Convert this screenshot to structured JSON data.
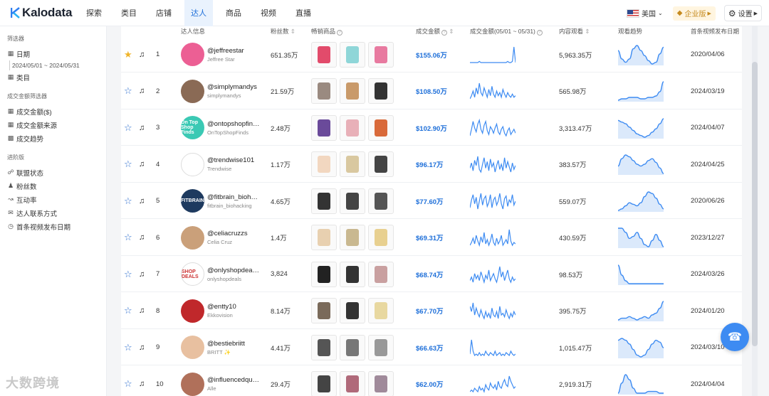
{
  "app": {
    "name": "Kalodata"
  },
  "nav": {
    "items": [
      "探索",
      "类目",
      "店铺",
      "达人",
      "商品",
      "视频",
      "直播"
    ],
    "active_index": 3,
    "country": "美国",
    "enterprise": "企业版",
    "settings": "设置"
  },
  "sidebar": {
    "filter_title": "筛选器",
    "date_label": "日期",
    "date_range": "2024/05/01 ~ 2024/05/31",
    "category_label": "类目",
    "gmv_filter_title": "成交金额筛选器",
    "gmv_items": [
      "成交金额($)",
      "成交金额来源",
      "成交趋势"
    ],
    "advanced_title": "进阶版",
    "advanced_items": [
      "联盟状态",
      "粉丝数",
      "互动率",
      "达人联系方式",
      "首条视频发布日期"
    ]
  },
  "watermark": "大数跨境",
  "table": {
    "headers": {
      "influencer": "达人信息",
      "fans": "粉丝数",
      "products": "畅销商品",
      "gmv": "成交金额",
      "gmv_trend": "成交金额(05/01 ~ 05/31)",
      "views": "内容观看",
      "view_trend": "观看趋势",
      "first_video": "首条视频发布日期"
    },
    "rows": [
      {
        "rank": "1",
        "handle": "@jeffreestar",
        "name": "Jeffree Star",
        "fans": "651.35万",
        "gmv": "$155.06万",
        "views": "5,963.35万",
        "date": "2020/04/06",
        "starred": true,
        "avatar_color": "#ec5f94",
        "avatar_text": "",
        "gmv_trend": [
          2,
          2,
          2,
          2,
          2,
          2,
          3,
          2,
          2,
          2,
          2,
          2,
          2,
          2,
          2,
          2,
          2,
          2,
          2,
          2,
          2,
          2,
          2,
          2,
          3,
          2,
          2,
          3,
          16,
          2
        ],
        "view_trend": [
          12,
          7,
          5,
          7,
          13,
          15,
          12,
          9,
          6,
          4,
          5,
          10,
          14
        ]
      },
      {
        "rank": "2",
        "handle": "@simplymandys",
        "name": "simplymandys",
        "fans": "21.59万",
        "gmv": "$108.50万",
        "views": "565.98万",
        "date": "2024/03/19",
        "starred": false,
        "avatar_color": "#8a6a55",
        "avatar_text": "",
        "gmv_trend": [
          2,
          4,
          7,
          3,
          9,
          5,
          12,
          6,
          4,
          9,
          6,
          3,
          8,
          4,
          10,
          5,
          3,
          7,
          4,
          6,
          3,
          8,
          5,
          3,
          6,
          4,
          3,
          5,
          3,
          4
        ],
        "view_trend": [
          3,
          4,
          4,
          5,
          5,
          5,
          4,
          4,
          5,
          5,
          6,
          9,
          16
        ]
      },
      {
        "rank": "3",
        "handle": "@ontopshopfin…",
        "name": "OnTopShopFinds",
        "fans": "2.48万",
        "gmv": "$102.90万",
        "views": "3,313.47万",
        "date": "2024/04/07",
        "starred": false,
        "avatar_color": "#3bc9b4",
        "avatar_text": "On Top Shop Finds",
        "gmv_trend": [
          3,
          8,
          14,
          9,
          6,
          12,
          15,
          8,
          5,
          11,
          14,
          7,
          4,
          10,
          8,
          5,
          9,
          12,
          6,
          4,
          8,
          10,
          5,
          3,
          7,
          9,
          4,
          6,
          8,
          5
        ],
        "view_trend": [
          14,
          13,
          12,
          10,
          8,
          6,
          5,
          4,
          5,
          7,
          9,
          12,
          15
        ]
      },
      {
        "rank": "4",
        "handle": "@trendwise101",
        "name": "Trendwise",
        "fans": "1.17万",
        "gmv": "$96.17万",
        "views": "383.57万",
        "date": "2024/04/25",
        "starred": false,
        "avatar_color": "#ffffff",
        "avatar_text": "",
        "gmv_trend": [
          6,
          10,
          4,
          12,
          8,
          15,
          5,
          3,
          9,
          14,
          6,
          11,
          4,
          13,
          7,
          10,
          3,
          8,
          12,
          5,
          9,
          4,
          14,
          6,
          11,
          7,
          3,
          10,
          5,
          8
        ],
        "view_trend": [
          8,
          12,
          14,
          13,
          11,
          9,
          8,
          9,
          11,
          12,
          10,
          7,
          4
        ]
      },
      {
        "rank": "5",
        "handle": "@fitbrain_bioh…",
        "name": "fitbrain_biohacking",
        "fans": "4.65万",
        "gmv": "$77.60万",
        "views": "559.07万",
        "date": "2020/06/26",
        "starred": false,
        "avatar_color": "#1e3a5f",
        "avatar_text": "FITBRAIN",
        "gmv_trend": [
          4,
          10,
          14,
          7,
          12,
          3,
          9,
          15,
          6,
          11,
          13,
          5,
          8,
          14,
          4,
          10,
          12,
          6,
          9,
          15,
          7,
          3,
          11,
          13,
          5,
          10,
          8,
          14,
          6,
          9
        ],
        "view_trend": [
          3,
          4,
          6,
          8,
          7,
          6,
          8,
          12,
          15,
          14,
          11,
          7,
          4
        ]
      },
      {
        "rank": "6",
        "handle": "@celiacruzzs",
        "name": "Celia Cruz",
        "fans": "1.4万",
        "gmv": "$69.31万",
        "views": "430.59万",
        "date": "2023/12/27",
        "starred": false,
        "avatar_color": "#caa07a",
        "avatar_text": "",
        "gmv_trend": [
          3,
          5,
          8,
          4,
          10,
          6,
          3,
          9,
          5,
          12,
          4,
          7,
          3,
          6,
          11,
          5,
          3,
          8,
          4,
          6,
          10,
          3,
          5,
          7,
          4,
          14,
          6,
          3,
          5,
          4
        ],
        "view_trend": [
          14,
          14,
          12,
          9,
          10,
          12,
          9,
          6,
          5,
          8,
          11,
          8,
          5
        ]
      },
      {
        "rank": "7",
        "handle": "@onlyshopdea…",
        "name": "onlyshopdeals",
        "fans": "3,824",
        "gmv": "$68.74万",
        "views": "98.53万",
        "date": "2024/03/26",
        "starred": false,
        "avatar_color": "#ffffff",
        "avatar_text": "SHOP DEALS",
        "gmv_trend": [
          4,
          6,
          3,
          8,
          5,
          7,
          4,
          9,
          6,
          3,
          7,
          5,
          10,
          4,
          6,
          8,
          5,
          3,
          7,
          12,
          6,
          9,
          4,
          7,
          10,
          5,
          3,
          6,
          4,
          5
        ],
        "view_trend": [
          15,
          8,
          4,
          2,
          2,
          2,
          2,
          2,
          2,
          2,
          2,
          2,
          2
        ]
      },
      {
        "rank": "8",
        "handle": "@entty10",
        "name": "Ekkovision",
        "fans": "8.14万",
        "gmv": "$67.70万",
        "views": "395.75万",
        "date": "2024/01/20",
        "starred": false,
        "avatar_color": "#c0282b",
        "avatar_text": "",
        "gmv_trend": [
          10,
          7,
          12,
          5,
          9,
          6,
          4,
          8,
          5,
          3,
          7,
          4,
          6,
          3,
          9,
          5,
          4,
          7,
          3,
          10,
          5,
          6,
          4,
          8,
          5,
          3,
          6,
          4,
          7,
          5
        ],
        "view_trend": [
          4,
          5,
          5,
          6,
          5,
          4,
          5,
          6,
          5,
          7,
          8,
          11,
          15
        ]
      },
      {
        "rank": "9",
        "handle": "@bestiebriitt",
        "name": "BRITT ✨",
        "fans": "4.41万",
        "gmv": "$66.63万",
        "views": "1,015.47万",
        "date": "2024/03/10",
        "starred": false,
        "avatar_color": "#e8c0a0",
        "avatar_text": "",
        "gmv_trend": [
          4,
          14,
          6,
          3,
          4,
          3,
          5,
          3,
          4,
          3,
          6,
          4,
          3,
          5,
          4,
          3,
          6,
          3,
          4,
          5,
          3,
          4,
          3,
          5,
          4,
          3,
          6,
          4,
          3,
          4
        ],
        "view_trend": [
          13,
          14,
          13,
          11,
          8,
          5,
          4,
          5,
          8,
          11,
          13,
          12,
          9
        ]
      },
      {
        "rank": "10",
        "handle": "@influencedqu…",
        "name": "Alle",
        "fans": "29.4万",
        "gmv": "$62.00万",
        "views": "2,919.31万",
        "date": "2024/04/04",
        "starred": false,
        "avatar_color": "#b0705a",
        "avatar_text": "",
        "gmv_trend": [
          3,
          4,
          3,
          5,
          4,
          3,
          6,
          4,
          5,
          3,
          7,
          5,
          4,
          8,
          6,
          5,
          7,
          4,
          9,
          6,
          5,
          8,
          10,
          7,
          6,
          12,
          9,
          7,
          5,
          6
        ],
        "view_trend": [
          4,
          10,
          15,
          12,
          7,
          4,
          4,
          4,
          5,
          5,
          5,
          4,
          4
        ]
      }
    ]
  }
}
